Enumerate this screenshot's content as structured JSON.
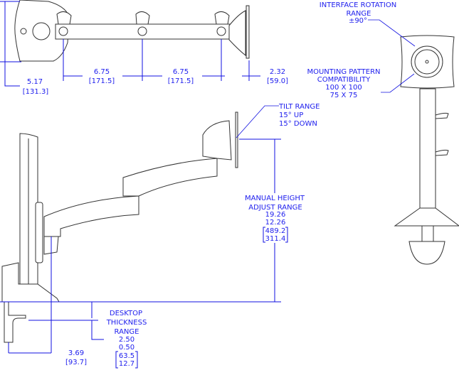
{
  "top_view": {
    "depth": {
      "in": "5.17",
      "mm": "[131.3]"
    },
    "spacing_1": {
      "in": "6.75",
      "mm": "[171.5]"
    },
    "spacing_2": {
      "in": "6.75",
      "mm": "[171.5]"
    },
    "head_offset": {
      "in": "2.32",
      "mm": "[59.0]"
    }
  },
  "side_view": {
    "tilt": {
      "title": "TILT RANGE",
      "up": "15° UP",
      "down": "15° DOWN"
    },
    "height": {
      "line1": "MANUAL HEIGHT",
      "line2": "ADJUST RANGE",
      "max_in": "19.26",
      "min_in": "12.26",
      "max_mm": "489.2",
      "min_mm": "311.4"
    },
    "desktop": {
      "line1": "DESKTOP",
      "line2": "THICKNESS",
      "line3": "RANGE",
      "max_in": "2.50",
      "min_in": "0.50",
      "max_mm": "63.5",
      "min_mm": "12.7"
    },
    "clamp_offset": {
      "in": "3.69",
      "mm": "[93.7]"
    }
  },
  "front_view": {
    "rotation": {
      "line1": "INTERFACE ROTATION",
      "line2": "RANGE",
      "value": "±90°"
    },
    "mounting": {
      "line1": "MOUNTING PATTERN",
      "line2": "COMPATIBILITY",
      "pattern1": "100 X 100",
      "pattern2": "75 X 75"
    }
  },
  "colors": {
    "dimension": "#1010e0",
    "outline": "#333333"
  }
}
